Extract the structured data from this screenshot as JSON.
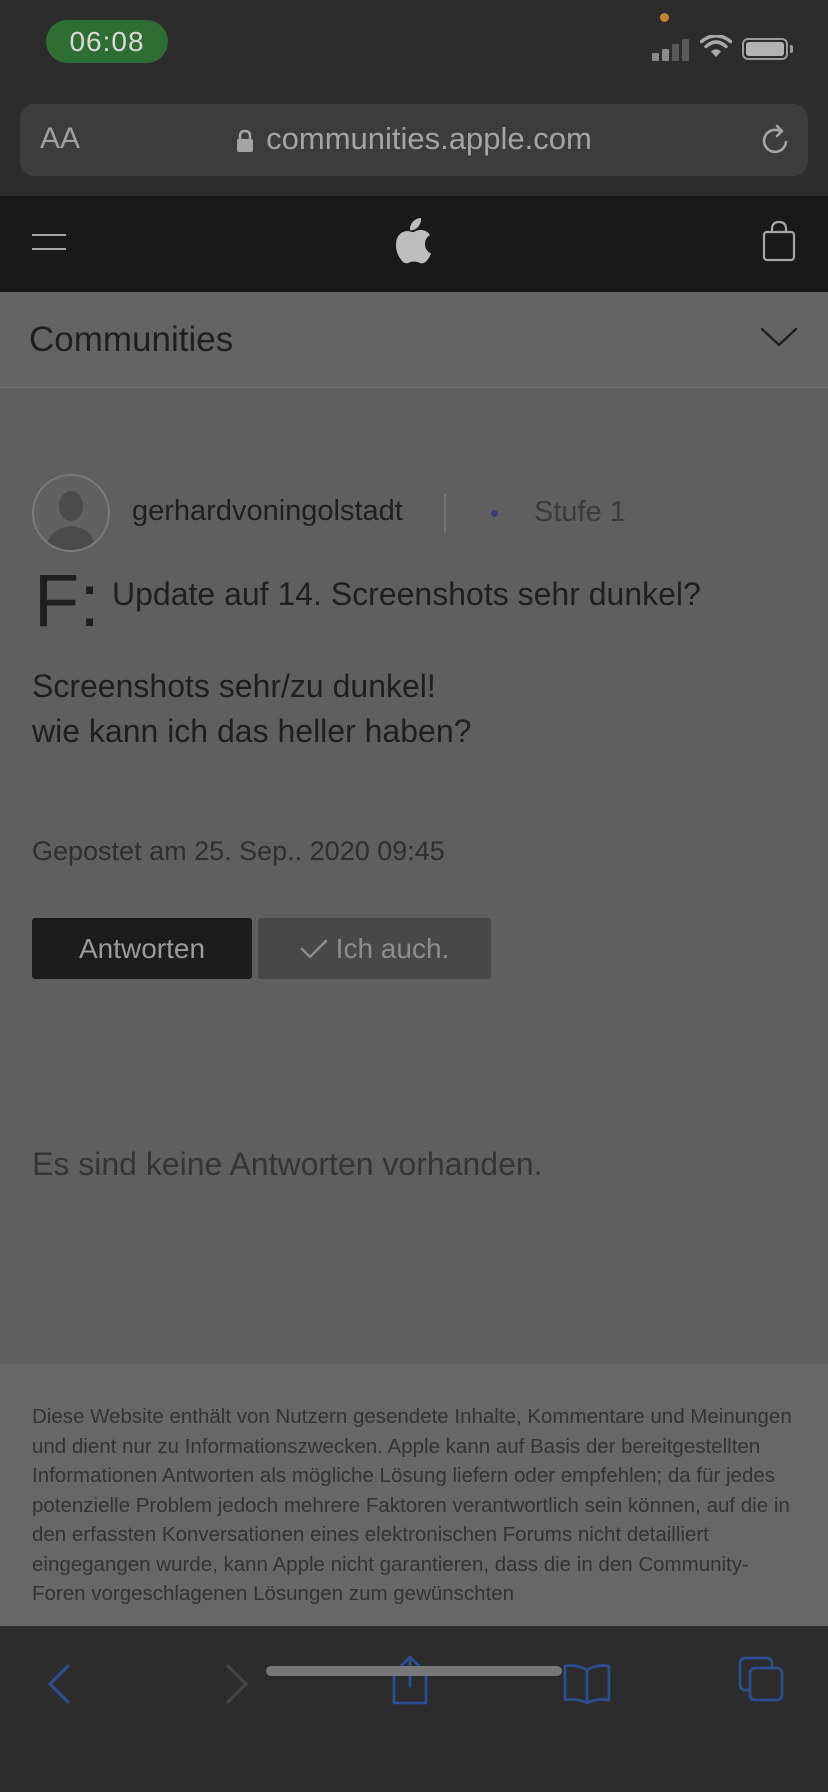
{
  "status_bar": {
    "time": "06:08"
  },
  "browser": {
    "text_size_label": "AA",
    "url": "communities.apple.com"
  },
  "site_nav": {
    "section_title": "Communities"
  },
  "post": {
    "author": "gerhardvoningolstadt",
    "level": "Stufe 1",
    "question_mark": "F:",
    "title": "Update auf 14. Screenshots sehr dunkel?",
    "body_lines": [
      "Screenshots sehr/zu dunkel!",
      "wie kann ich das heller haben?"
    ],
    "posted": "Gepostet am 25. Sep.. 2020 09:45",
    "reply_button": "Antworten",
    "me_too_button": "Ich auch."
  },
  "answers": {
    "empty_text": "Es sind keine Antworten vorhanden."
  },
  "footer": {
    "disclaimer": "Diese Website enthält von Nutzern gesendete Inhalte, Kommentare und Meinungen und dient nur zu Informationszwecken. Apple kann auf Basis der bereitgestellten Informationen Antworten als mögliche Lösung liefern oder empfehlen; da für jedes potenzielle Problem jedoch mehrere Faktoren verantwortlich sein können, auf die in den erfassten Konversationen eines elektronischen Forums nicht detailliert eingegangen wurde, kann Apple nicht garantieren, dass die in den Community-Foren vorgeschlagenen Lösungen zum gewünschten"
  },
  "toolbar": {
    "icons": [
      "back-icon",
      "forward-icon",
      "share-icon",
      "bookmarks-icon",
      "tabs-icon"
    ]
  },
  "colors": {
    "accent": "#2d4e8f",
    "status_pill": "#2f6e32",
    "orange_indicator": "#c7832e"
  }
}
